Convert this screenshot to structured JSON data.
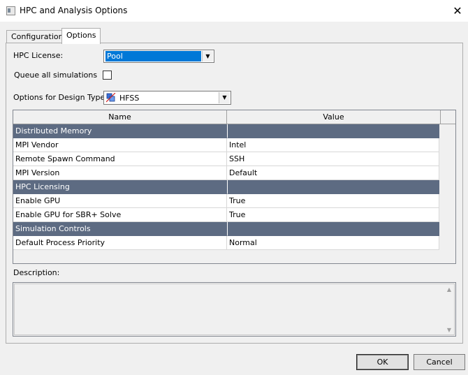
{
  "window": {
    "title": "HPC and Analysis Options",
    "close_glyph": "✕"
  },
  "tabs": [
    {
      "label": "Configurations",
      "active": false
    },
    {
      "label": "Options",
      "active": true
    }
  ],
  "options": {
    "hpc_license_label": "HPC License:",
    "hpc_license_value": "Pool",
    "queue_label": "Queue all simulations",
    "queue_checked": false,
    "design_type_label": "Options for Design Type:",
    "design_type_value": "HFSS",
    "design_type_icon": "hfss-icon"
  },
  "grid": {
    "columns": [
      "Name",
      "Value"
    ],
    "rows": [
      {
        "name": "Distributed Memory",
        "value": "",
        "group": true
      },
      {
        "name": "MPI Vendor",
        "value": "Intel",
        "group": false
      },
      {
        "name": "Remote Spawn Command",
        "value": "SSH",
        "group": false
      },
      {
        "name": "MPI Version",
        "value": "Default",
        "group": false
      },
      {
        "name": "HPC Licensing",
        "value": "",
        "group": true
      },
      {
        "name": "Enable GPU",
        "value": "True",
        "group": false
      },
      {
        "name": "Enable GPU for SBR+ Solve",
        "value": "True",
        "group": false
      },
      {
        "name": "Simulation Controls",
        "value": "",
        "group": true
      },
      {
        "name": "Default Process Priority",
        "value": "Normal",
        "group": false
      }
    ]
  },
  "description": {
    "label": "Description:",
    "text": ""
  },
  "buttons": {
    "ok": "OK",
    "cancel": "Cancel"
  },
  "colors": {
    "group_row_bg": "#5d6b82",
    "selection_blue": "#0078d7"
  }
}
